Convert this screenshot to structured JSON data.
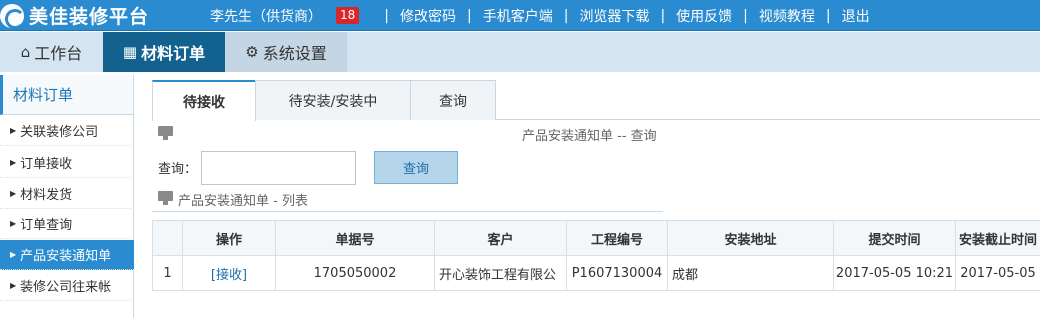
{
  "header": {
    "logo_text": "美佳装修平台",
    "user": "李先生（供货商）",
    "badge": "18",
    "links": [
      "修改密码",
      "手机客户端",
      "浏览器下载",
      "使用反馈",
      "视频教程",
      "退出"
    ]
  },
  "main_tabs": [
    {
      "label": "工作台",
      "icon": "home-icon"
    },
    {
      "label": "材料订单",
      "icon": "grid-icon"
    },
    {
      "label": "系统设置",
      "icon": "gear-icon"
    }
  ],
  "sidebar": {
    "title": "材料订单",
    "items": [
      "关联装修公司",
      "订单接收",
      "材料发货",
      "订单查询",
      "产品安装通知单",
      "装修公司往来帐"
    ],
    "active_index": 4
  },
  "sub_tabs": [
    "待接收",
    "待安装/安装中",
    "查询"
  ],
  "query_title": "产品安装通知单 -- 查询",
  "search": {
    "label": "查询：",
    "value": "",
    "placeholder": "",
    "button": "查询"
  },
  "list_title": "产品安装通知单 - 列表",
  "table": {
    "headers": [
      "",
      "操作",
      "单据号",
      "客户",
      "工程编号",
      "安装地址",
      "提交时间",
      "安装截止时间"
    ],
    "rows": [
      [
        "1",
        "[接收]",
        "1705050002",
        "开心装饰工程有限公",
        "P1607130004",
        "成都",
        "2017-05-05 10:21",
        "2017-05-05"
      ]
    ]
  },
  "colors": {
    "accent": "#2a8bd0",
    "active_tab": "#13618f",
    "badge": "#d9262a"
  }
}
